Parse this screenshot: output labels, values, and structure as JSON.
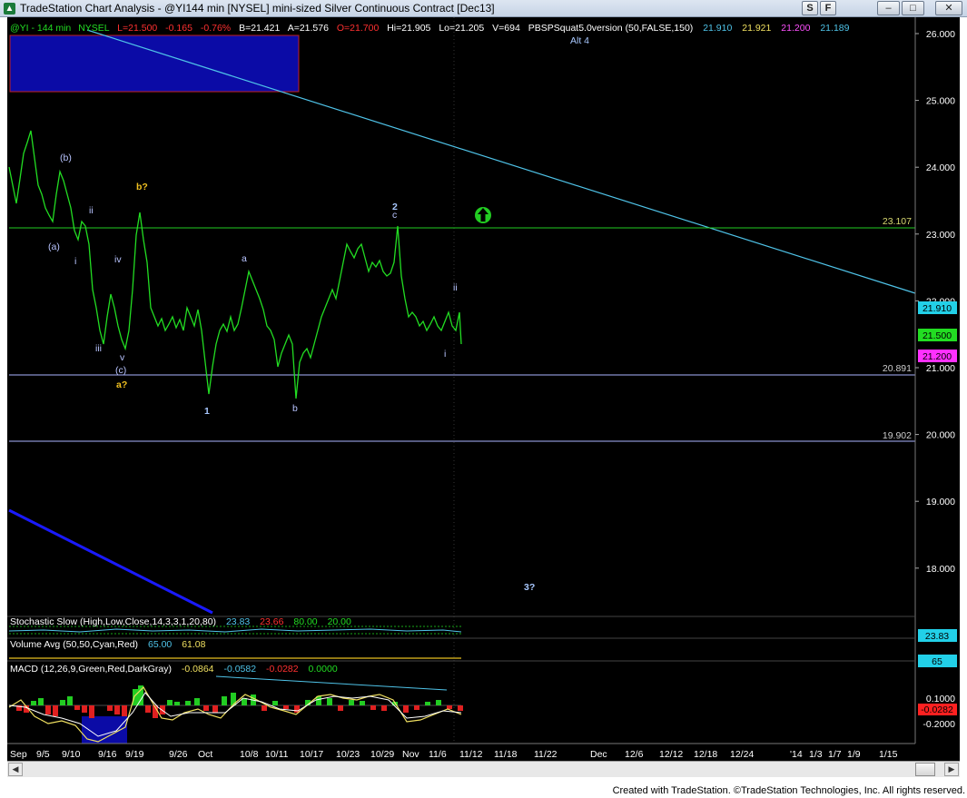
{
  "window": {
    "title": "TradeStation Chart Analysis - @YI144 min [NYSEL] mini-sized Silver Continuous Contract [Dec13]",
    "btn_s": "S",
    "btn_f": "F",
    "minimize": "–",
    "maximize": "□",
    "close": "✕"
  },
  "legend": {
    "symbol": "@YI - 144 min",
    "exchange": "NYSEL",
    "last": "L=21.500",
    "change": "-0.165",
    "change_pct": "-0.76%",
    "bid": "B=21.421",
    "ask": "A=21.576",
    "open": "O=21.700",
    "high": "Hi=21.905",
    "low": "Lo=21.205",
    "volume": "V=694",
    "indicator": "PBSPSquat5.0version (50,FALSE,150)",
    "ind_v1": "21.910",
    "ind_v2": "21.921",
    "ind_v3": "21.200",
    "ind_v4": "21.189",
    "alt": "Alt 4"
  },
  "price_axis": {
    "ticks": [
      "26.000",
      "25.000",
      "24.000",
      "23.000",
      "22.000",
      "21.000",
      "20.000",
      "19.000",
      "18.000"
    ],
    "tag_upper": "21.910",
    "tag_last": "21.500",
    "tag_lower": "21.200"
  },
  "levels": {
    "green_line": "23.107",
    "line_a": "20.891",
    "line_b": "19.902"
  },
  "wave_labels": {
    "a_paren": "(a)",
    "b_paren": "(b)",
    "c_paren": "(c)",
    "i_1": "i",
    "ii_1": "ii",
    "iii": "iii",
    "iv": "iv",
    "v": "v",
    "a_q": "a?",
    "b_q": "b?",
    "one": "1",
    "a_small": "a",
    "b_small": "b",
    "two": "2",
    "c_small": "c",
    "i_2": "i",
    "ii_2": "ii",
    "three_q": "3?"
  },
  "stochastic": {
    "label": "Stochastic Slow (High,Low,Close,14,3,3,1,20,80)",
    "v1": "23.83",
    "v2": "23.66",
    "v3": "80.00",
    "v4": "20.00",
    "tag": "23.83"
  },
  "volume_avg": {
    "label": "Volume Avg (50,50,Cyan,Red)",
    "v1": "65.00",
    "v2": "61.08",
    "tag": "65"
  },
  "macd": {
    "label": "MACD (12,26,9,Green,Red,DarkGray)",
    "v1": "-0.0864",
    "v2": "-0.0582",
    "v3": "-0.0282",
    "v4": "0.0000",
    "tick_top": "0.1000",
    "tick_bottom": "-0.2000",
    "tag": "-0.0282"
  },
  "date_axis": [
    "Sep",
    "9/5",
    "9/10",
    "9/16",
    "9/19",
    "9/26",
    "Oct",
    "10/8",
    "10/11",
    "10/17",
    "10/23",
    "10/29",
    "Nov",
    "11/6",
    "11/12",
    "11/18",
    "11/22",
    "Dec",
    "12/6",
    "12/12",
    "12/18",
    "12/24",
    "'14",
    "1/3",
    "1/7",
    "1/9",
    "1/15"
  ],
  "footer": {
    "credit": "Created with TradeStation. ©TradeStation Technologies, Inc. All rights reserved."
  },
  "colors": {
    "background": "#000000",
    "price": "#22dd22",
    "trendline": "#4fc3e8",
    "blue_line": "#1a1aff",
    "box": "#0b0ba6",
    "level_green": "#22cc22",
    "level_lavender": "#aab4ff"
  }
}
